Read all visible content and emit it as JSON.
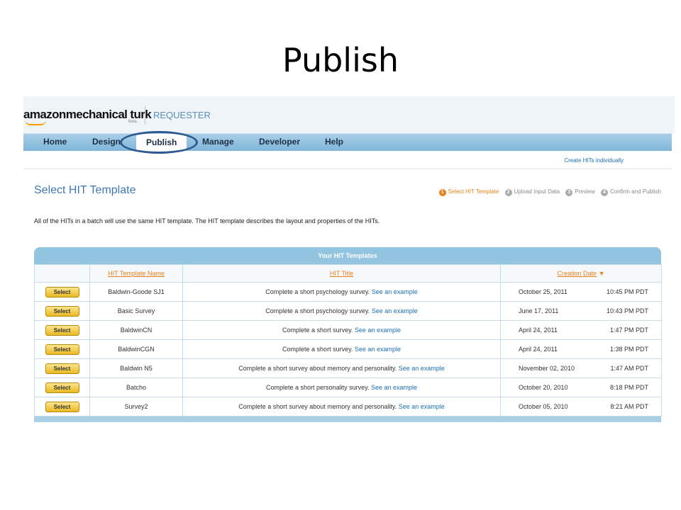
{
  "slide": {
    "title": "Publish"
  },
  "header": {
    "logo_bold": "amazon",
    "logo_rest": "mechanical turk",
    "logo_beta": "beta",
    "requester": "REQUESTER"
  },
  "nav": {
    "items": [
      "Home",
      "Design",
      "Publish",
      "Manage",
      "Developer",
      "Help"
    ],
    "active": "Publish"
  },
  "subbar": {
    "create_link": "Create HITs individually"
  },
  "page": {
    "heading": "Select HIT Template",
    "description": "All of the HITs in a batch will use the same HIT template. The HIT template describes the layout and properties of the HITs."
  },
  "steps": [
    {
      "num": "1",
      "label": "Select HIT Template"
    },
    {
      "num": "2",
      "label": "Upload Input Data"
    },
    {
      "num": "3",
      "label": "Preview"
    },
    {
      "num": "4",
      "label": "Confirm and Publish"
    }
  ],
  "table": {
    "title": "Your HIT Templates",
    "columns": [
      "HIT Template Name",
      "HIT Title",
      "Creation Date"
    ],
    "sort_indicator": "▼",
    "select_label": "Select",
    "example_label": "See an example",
    "rows": [
      {
        "name": "Baldwin-Goode SJ1",
        "title": "Complete a short psychology survey.",
        "date": "October 25, 2011",
        "time": "10:45 PM PDT"
      },
      {
        "name": "Basic Survey",
        "title": "Complete a short psychology survey.",
        "date": "June 17, 2011",
        "time": "10:43 PM PDT"
      },
      {
        "name": "BaldwinCN",
        "title": "Complete a short survey.",
        "date": "April 24, 2011",
        "time": "1:47 PM PDT"
      },
      {
        "name": "BaldwinCGN",
        "title": "Complete a short survey.",
        "date": "April 24, 2011",
        "time": "1:38 PM PDT"
      },
      {
        "name": "Baldwin N5",
        "title": "Complete a short survey about memory and personality.",
        "date": "November 02, 2010",
        "time": "1:47 AM PDT"
      },
      {
        "name": "Batcho",
        "title": "Complete a short personality survey.",
        "date": "October 20, 2010",
        "time": "8:18 PM PDT"
      },
      {
        "name": "Survey2",
        "title": "Complete a short survey about memory and personality.",
        "date": "October 05, 2010",
        "time": "8:21 AM PDT"
      }
    ]
  },
  "colors": {
    "nav_blue": "#7fb5d8",
    "accent_orange": "#e8801a",
    "link_blue": "#1b6fb5",
    "highlight_circle": "#2d5a91"
  }
}
